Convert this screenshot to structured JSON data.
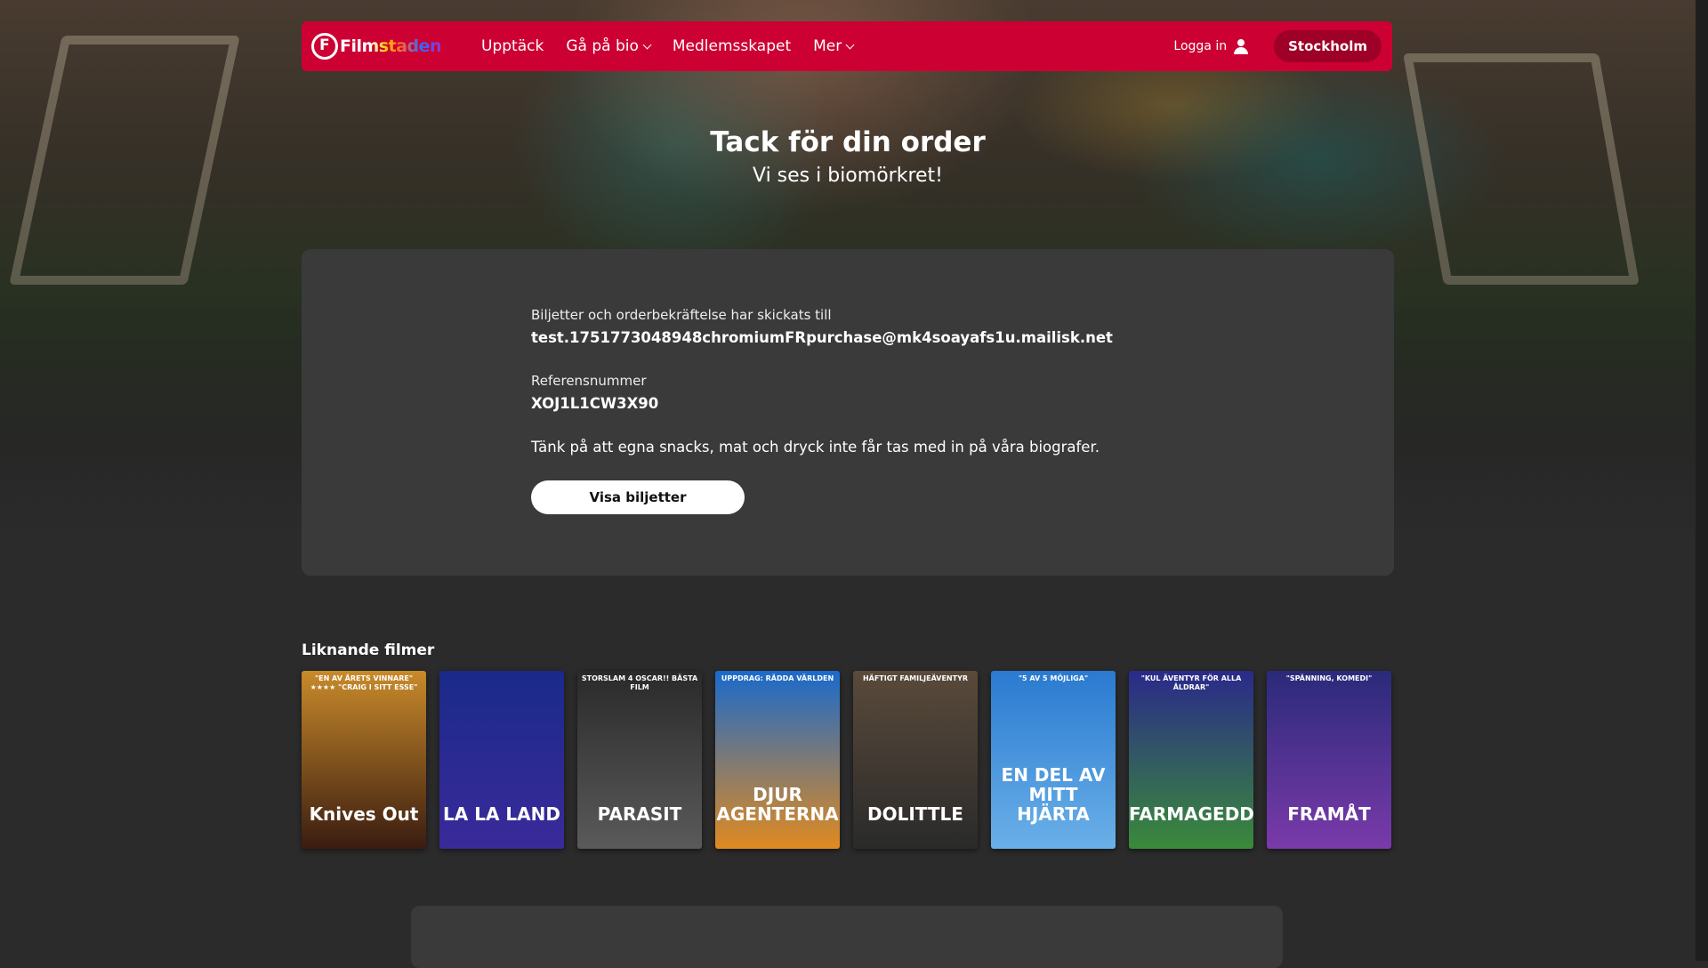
{
  "nav": {
    "logo_text": "Filmstaden",
    "links": [
      {
        "label": "Upptäck",
        "dropdown": false
      },
      {
        "label": "Gå på bio",
        "dropdown": true
      },
      {
        "label": "Medlemsskapet",
        "dropdown": false
      },
      {
        "label": "Mer",
        "dropdown": true
      }
    ],
    "login_label": "Logga in",
    "city": "Stockholm",
    "brand_color": "#cc0033"
  },
  "hero": {
    "title": "Tack för din order",
    "subtitle": "Vi ses i biomörkret!"
  },
  "order": {
    "sent_label": "Biljetter och orderbekräftelse har skickats till",
    "email": "test.1751773048948chromiumFRpurchase@mk4soayafs1u.mailisk.net",
    "ref_label": "Referensnummer",
    "ref_number": "XOJ1L1CW3X90",
    "notice": "Tänk på att egna snacks, mat och dryck inte får tas med in på våra biografer.",
    "button_label": "Visa biljetter"
  },
  "similar": {
    "title": "Liknande filmer",
    "movies": [
      {
        "title": "Knives Out",
        "tagline": "\"EN AV ÅRETS VINNARE\" ★★★★ \"CRAIG I SITT ESSE\"",
        "colors": [
          "#c88a2a",
          "#3a1c10"
        ]
      },
      {
        "title": "LA LA LAND",
        "tagline": "",
        "colors": [
          "#1a2a8a",
          "#3a2a9a"
        ]
      },
      {
        "title": "PARASIT",
        "tagline": "STORSLAM 4 OSCAR!! BÄSTA FILM",
        "colors": [
          "#2a2a2a",
          "#5a5a5a"
        ]
      },
      {
        "title": "DJUR AGENTERNA",
        "tagline": "UPPDRAG: RÄDDA VÄRLDEN",
        "colors": [
          "#1a6acc",
          "#e08a20"
        ]
      },
      {
        "title": "DOLITTLE",
        "tagline": "HÄFTIGT FAMILJEÄVENTYR",
        "colors": [
          "#5a4a3a",
          "#2a2a2a"
        ]
      },
      {
        "title": "EN DEL AV MITT HJÄRTA",
        "tagline": "\"5 AV 5 MÖJLIGA\"",
        "colors": [
          "#2a7ad0",
          "#6ab0e8"
        ]
      },
      {
        "title": "FARMAGEDDON",
        "tagline": "\"KUL ÄVENTYR FÖR ALLA ÅLDRAR\"",
        "colors": [
          "#2a2a8a",
          "#3a8a3a"
        ]
      },
      {
        "title": "FRAMÅT",
        "tagline": "\"SPÄNNING, KOMEDI\"",
        "colors": [
          "#2a2a7a",
          "#7a3aaa"
        ]
      }
    ]
  }
}
